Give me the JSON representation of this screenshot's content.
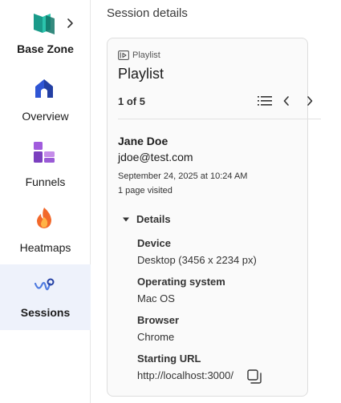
{
  "sidebar": {
    "brand": {
      "name": "Base Zone",
      "logo_icon": "brand-logo-icon",
      "chevron_icon": "chevron-right-icon"
    },
    "items": [
      {
        "label": "Overview",
        "icon": "home-icon",
        "active": false
      },
      {
        "label": "Funnels",
        "icon": "funnel-icon",
        "active": false
      },
      {
        "label": "Heatmaps",
        "icon": "flame-icon",
        "active": false
      },
      {
        "label": "Sessions",
        "icon": "sessions-icon",
        "active": true
      }
    ]
  },
  "main": {
    "title": "Session details",
    "card": {
      "kicker": "Playlist",
      "title": "Playlist",
      "pager": {
        "text": "1 of 5"
      },
      "user": {
        "name": "Jane Doe",
        "email": "jdoe@test.com",
        "date": "September 24, 2025 at 10:24 AM",
        "pages": "1 page visited"
      },
      "details": {
        "label": "Details",
        "fields": [
          {
            "label": "Device",
            "value": "Desktop (3456 x 2234 px)"
          },
          {
            "label": "Operating system",
            "value": "Mac OS"
          },
          {
            "label": "Browser",
            "value": "Chrome"
          },
          {
            "label": "Starting URL",
            "value": "http://localhost:3000/"
          }
        ]
      }
    }
  },
  "colors": {
    "brand_teal": "#1a9b8a",
    "home_blue": "#2f55d4",
    "funnel_purple": "#9a5bd6",
    "flame_orange": "#f2682a",
    "active_bg": "#eef2fb"
  }
}
